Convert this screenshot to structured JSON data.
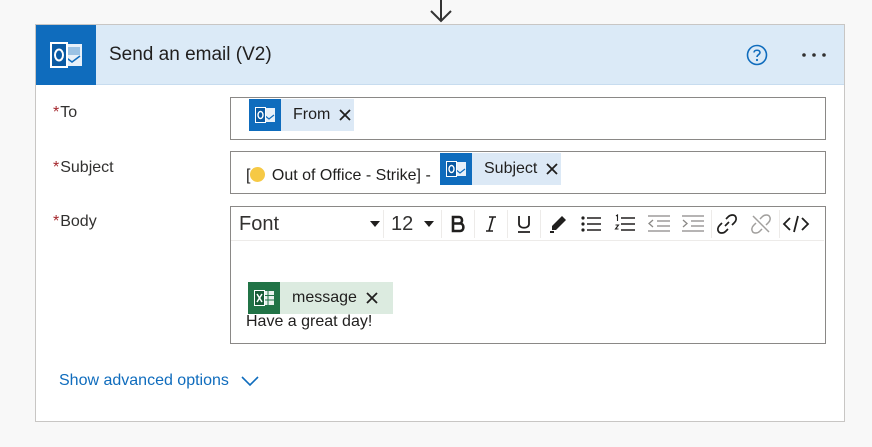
{
  "action": {
    "title": "Send an email (V2)",
    "icons": {
      "header": "outlook-icon",
      "help": "help-circle-icon",
      "more": "more-dots-icon",
      "flow": "arrow-down-icon"
    }
  },
  "fields": {
    "to": {
      "required_mark": "*",
      "label": "To",
      "token": {
        "label": "From",
        "icon": "outlook-icon",
        "remove": "×"
      }
    },
    "subject": {
      "required_mark": "*",
      "label": "Subject",
      "prefix_open": "[",
      "prefix_emoji": "raised-fist-emoji",
      "prefix_text": "Out of Office - Strike] -",
      "token": {
        "label": "Subject",
        "icon": "outlook-icon",
        "remove": "×"
      }
    },
    "body": {
      "required_mark": "*",
      "label": "Body",
      "toolbar": {
        "font": "Font",
        "size": "12",
        "buttons": [
          "bold-icon",
          "italic-icon",
          "underline-icon",
          "highlight-pen-icon",
          "bullet-list-icon",
          "numbered-list-icon",
          "decrease-indent-icon",
          "increase-indent-icon",
          "link-icon",
          "unlink-icon",
          "code-view-icon"
        ]
      },
      "token": {
        "label": "message",
        "icon": "excel-icon",
        "remove": "×"
      },
      "text": "Have a great day!"
    }
  },
  "advanced": {
    "label": "Show advanced options"
  },
  "colors": {
    "accent": "#0f6cbd",
    "header_bg": "#dbeaf7",
    "required": "#a4262c",
    "excel": "#217346"
  }
}
